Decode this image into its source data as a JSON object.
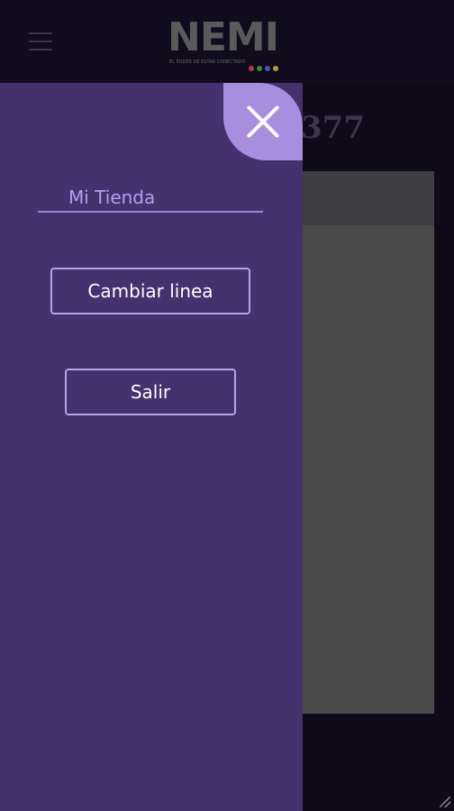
{
  "header": {
    "logo_text": "NEMI",
    "logo_tagline": "EL PODER DE ESTAR CONECTADO",
    "logo_dot_colors": [
      "#b23a3a",
      "#3a8c3a",
      "#3a5cb2",
      "#b29a3a"
    ],
    "menu_icon": "hamburger-icon"
  },
  "background": {
    "line_number": "377"
  },
  "drawer": {
    "close_icon": "close-icon",
    "store_label": "Mi Tienda",
    "change_line_label": "Cambiar linea",
    "exit_label": "Salir"
  },
  "colors": {
    "drawer_bg": "#47306e",
    "accent": "#a98ee0",
    "topbar_bg": "#100b1d"
  }
}
